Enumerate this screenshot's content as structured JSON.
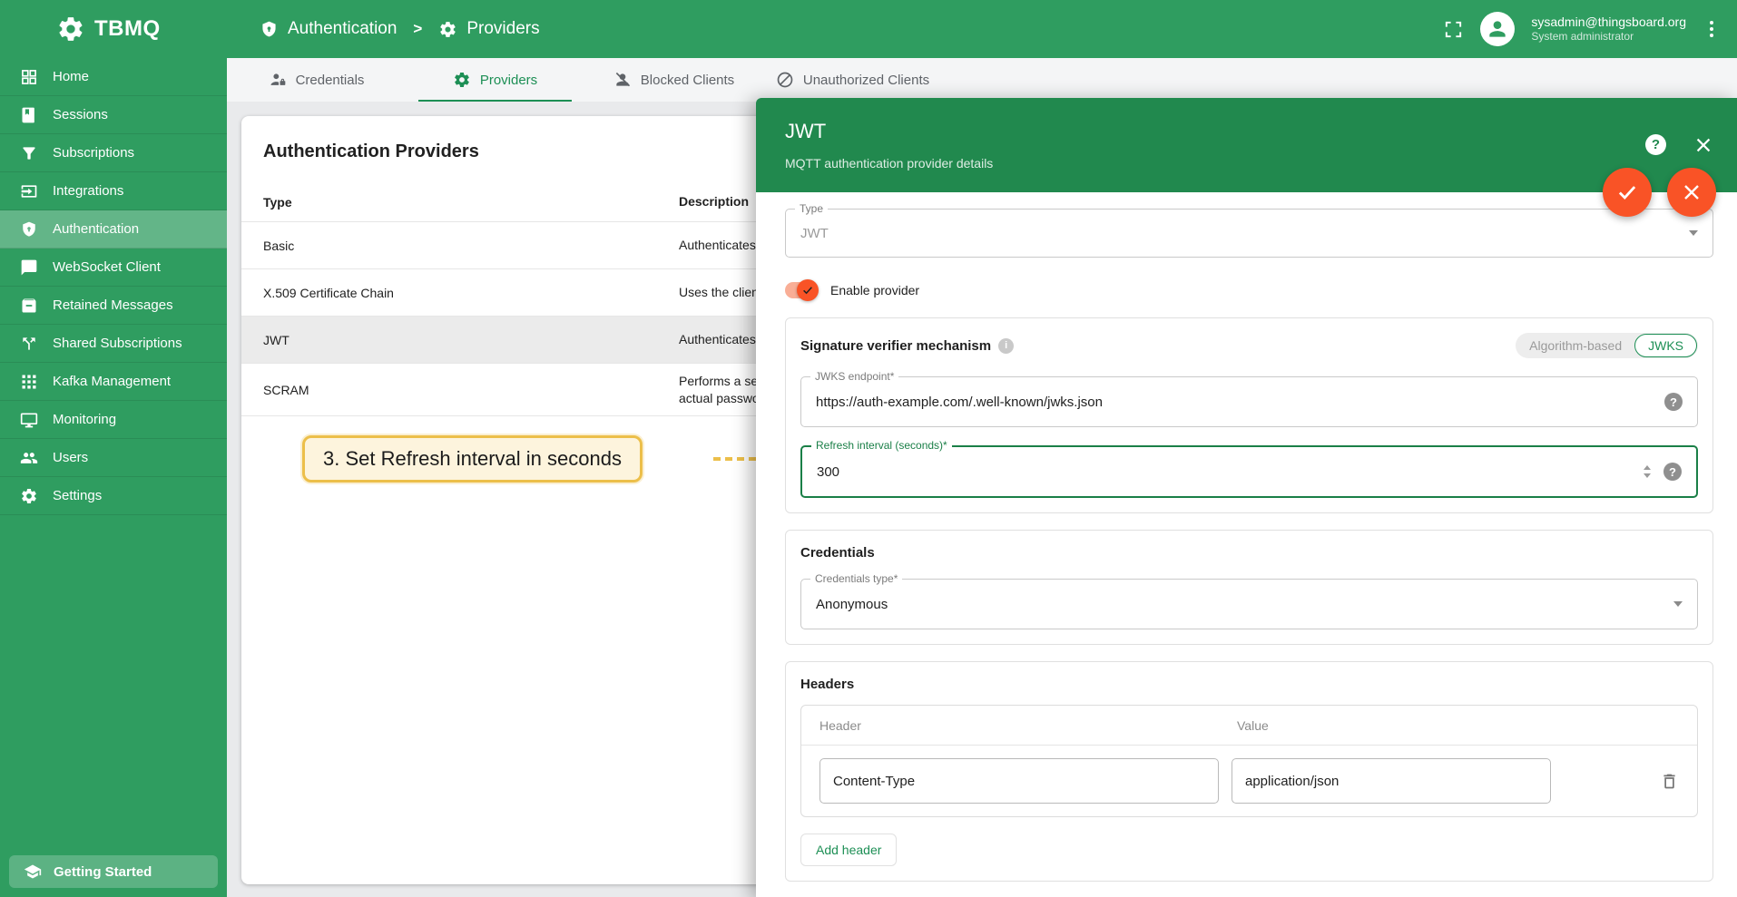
{
  "app": {
    "logo_text": "TBMQ"
  },
  "header": {
    "breadcrumb": [
      {
        "label": "Authentication",
        "icon": "shield-lock-icon"
      },
      {
        "label": "Providers",
        "icon": "gear-icon"
      }
    ],
    "breadcrumb_separator": ">",
    "user": {
      "email": "sysadmin@thingsboard.org",
      "role": "System administrator"
    }
  },
  "sidebar": {
    "items": [
      {
        "label": "Home",
        "icon": "dashboard-icon"
      },
      {
        "label": "Sessions",
        "icon": "book-icon"
      },
      {
        "label": "Subscriptions",
        "icon": "filter-icon"
      },
      {
        "label": "Integrations",
        "icon": "input-icon"
      },
      {
        "label": "Authentication",
        "icon": "shield-lock-icon",
        "active": true
      },
      {
        "label": "WebSocket Client",
        "icon": "chat-icon"
      },
      {
        "label": "Retained Messages",
        "icon": "archive-icon"
      },
      {
        "label": "Shared Subscriptions",
        "icon": "call-split-icon"
      },
      {
        "label": "Kafka Management",
        "icon": "grid-icon"
      },
      {
        "label": "Monitoring",
        "icon": "monitor-icon"
      },
      {
        "label": "Users",
        "icon": "people-icon"
      },
      {
        "label": "Settings",
        "icon": "gear-icon"
      }
    ],
    "getting_started": "Getting Started"
  },
  "tabs": [
    {
      "label": "Credentials",
      "icon": "person-lock-icon"
    },
    {
      "label": "Providers",
      "icon": "gear-icon",
      "active": true
    },
    {
      "label": "Blocked Clients",
      "icon": "person-off-icon"
    },
    {
      "label": "Unauthorized Clients",
      "icon": "block-icon"
    }
  ],
  "table": {
    "title": "Authentication Providers",
    "columns": {
      "type": "Type",
      "description": "Description"
    },
    "rows": [
      {
        "type": "Basic",
        "description": "Authenticates c"
      },
      {
        "type": "X.509 Certificate Chain",
        "description": "Uses the client"
      },
      {
        "type": "JWT",
        "description": "Authenticates c",
        "selected": true
      },
      {
        "type": "SCRAM",
        "description": "Performs a sec",
        "description_line2": "actual passwor"
      }
    ]
  },
  "annotation": {
    "text": "3. Set Refresh interval in seconds"
  },
  "panel": {
    "title": "JWT",
    "subtitle": "MQTT authentication provider details",
    "help_glyph": "?",
    "type_field": {
      "label": "Type",
      "value": "JWT"
    },
    "enable_provider": {
      "label": "Enable provider",
      "checked": true
    },
    "signature": {
      "label": "Signature verifier mechanism",
      "info_glyph": "i",
      "option_algorithm": "Algorithm-based",
      "option_jwks": "JWKS",
      "selected": "JWKS"
    },
    "jwks_endpoint": {
      "label": "JWKS endpoint*",
      "value": "https://auth-example.com/.well-known/jwks.json",
      "help_glyph": "?"
    },
    "refresh_interval": {
      "label": "Refresh interval (seconds)*",
      "value": "300",
      "help_glyph": "?"
    },
    "credentials": {
      "title": "Credentials",
      "type_label": "Credentials type*",
      "type_value": "Anonymous"
    },
    "headers": {
      "title": "Headers",
      "col_header": "Header",
      "col_value": "Value",
      "rows": [
        {
          "header": "Content-Type",
          "value": "application/json"
        }
      ],
      "add_button": "Add header"
    }
  },
  "colors": {
    "brand_green": "#2f9d60",
    "panel_header_green": "#21894e",
    "accent_green": "#1d8f55",
    "accent_orange": "#f95326",
    "annotation_border": "#ecbf4a",
    "annotation_bg": "#fdf4dd"
  }
}
